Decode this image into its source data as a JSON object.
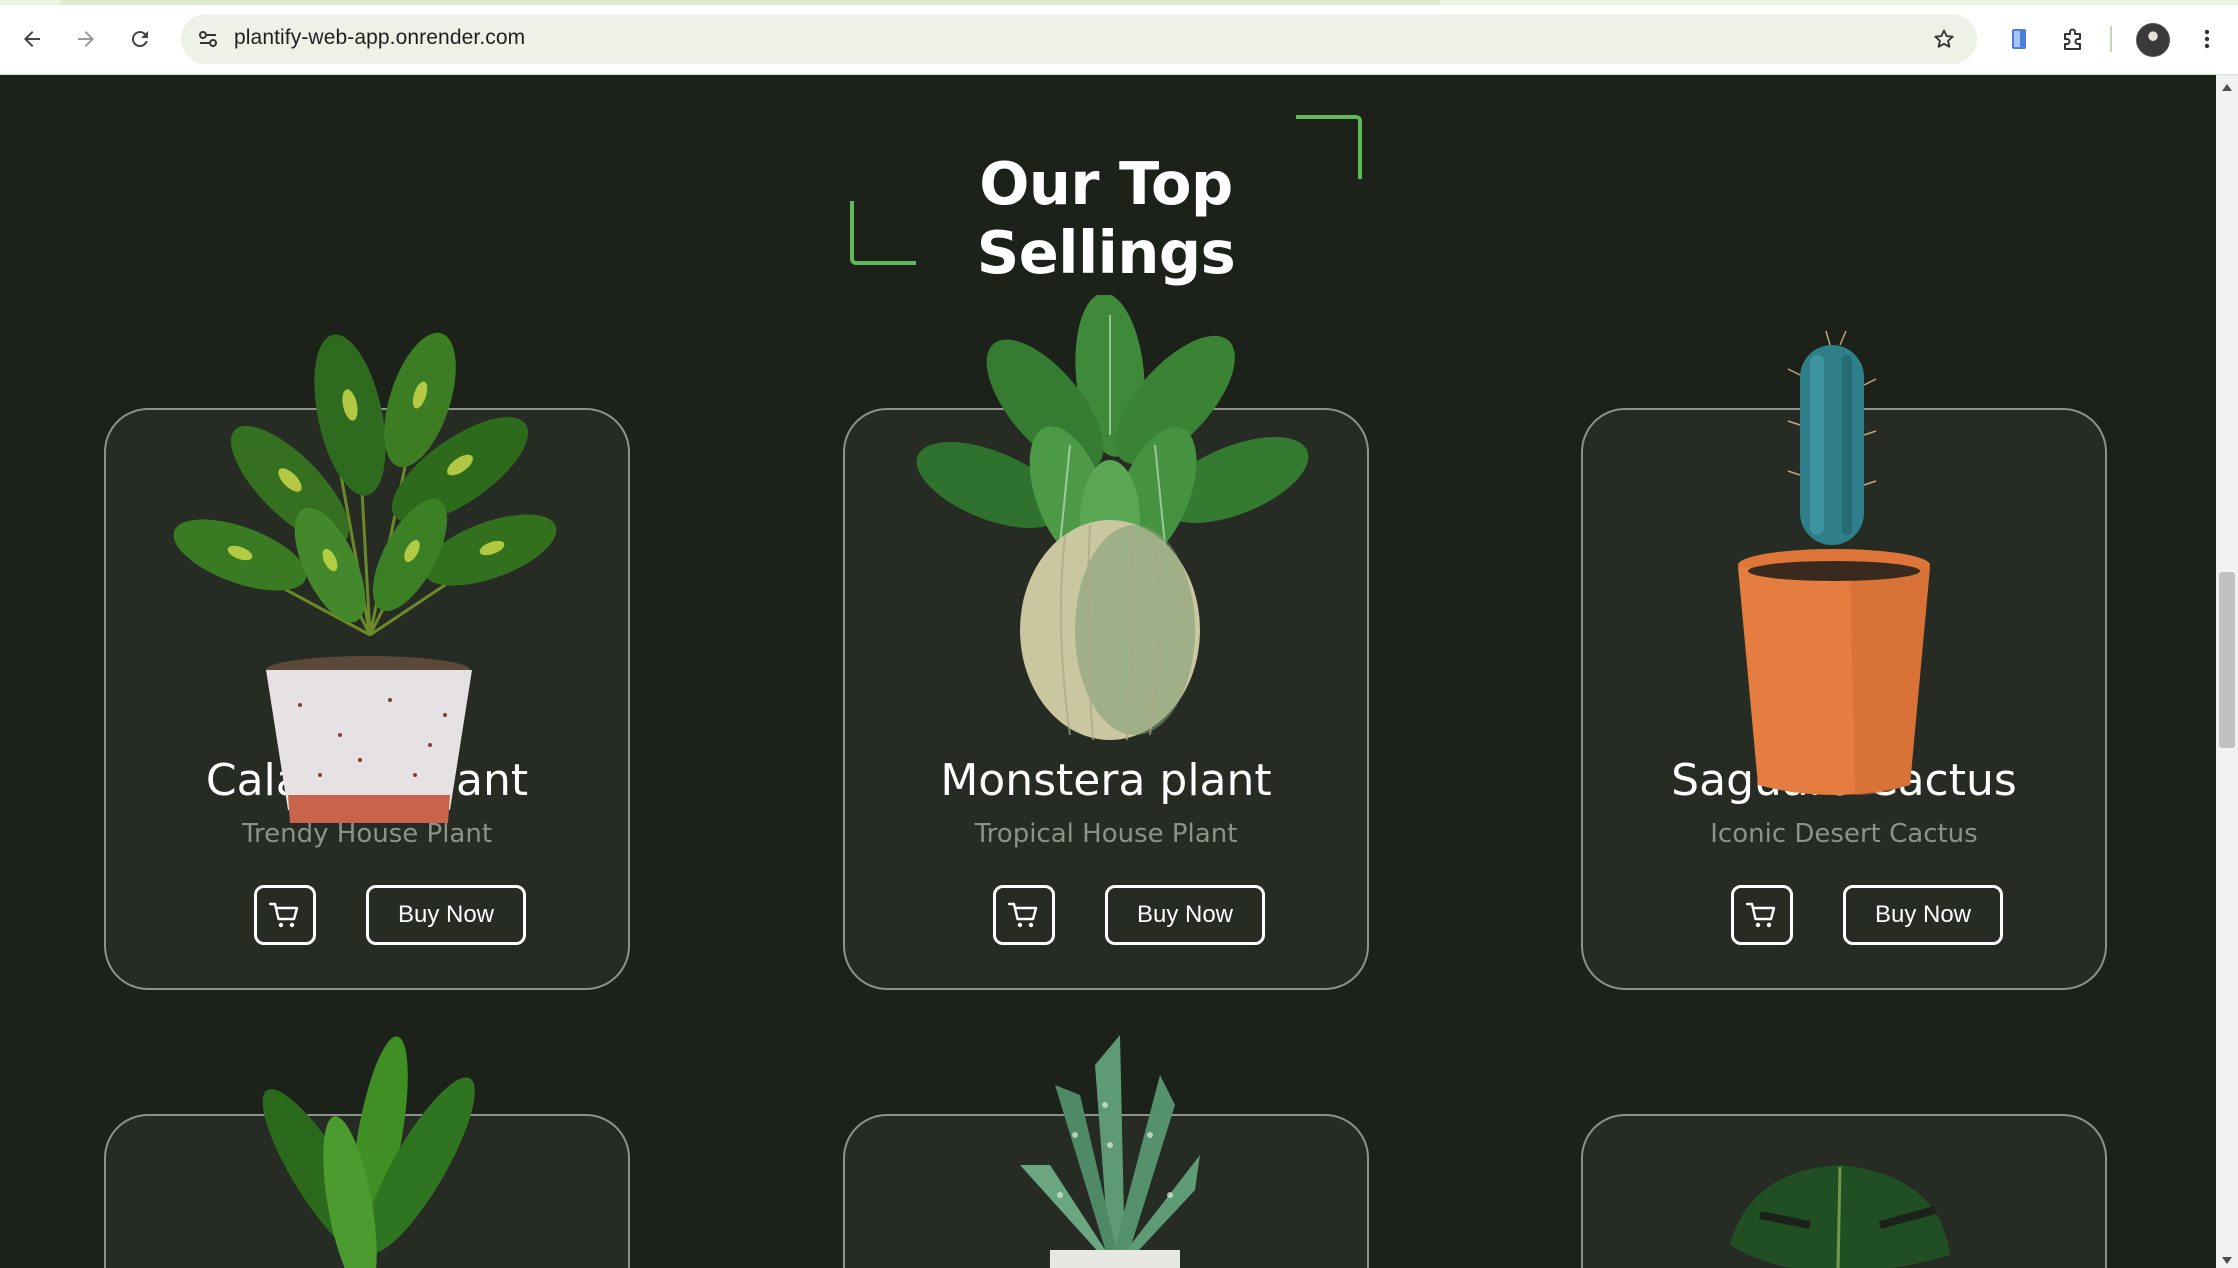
{
  "browser": {
    "url": "plantify-web-app.onrender.com",
    "icons": [
      "back-arrow-icon",
      "forward-arrow-icon",
      "reload-icon",
      "site-info-icon",
      "star-icon",
      "reading-mode-icon",
      "extensions-puzzle-icon",
      "profile-avatar",
      "more-vert-icon"
    ]
  },
  "section": {
    "title": "Our Top Sellings"
  },
  "products": [
    {
      "name": "Calathea plant",
      "tagline": "Trendy House Plant",
      "buy_label": "Buy Now"
    },
    {
      "name": "Monstera plant",
      "tagline": "Tropical House Plant",
      "buy_label": "Buy Now"
    },
    {
      "name": "Saguaro Cactus",
      "tagline": "Iconic Desert Cactus",
      "buy_label": "Buy Now"
    }
  ],
  "colors": {
    "page_bg": "#1c2119",
    "card_bg": "#262b23",
    "card_border": "#8d9388",
    "accent": "#5fb85a",
    "text_primary": "#ffffff",
    "text_muted": "#8d9288"
  }
}
